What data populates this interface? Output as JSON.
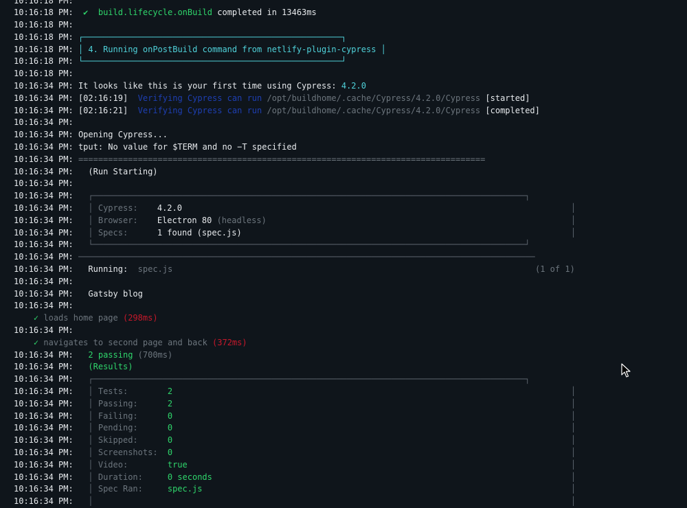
{
  "timestamps": {
    "t1": "10:16:18 PM:",
    "t2": "10:16:34 PM:"
  },
  "build": {
    "check": "✔",
    "task": "build.lifecycle.onBuild",
    "completed": " completed in 13463ms"
  },
  "plugin_box": {
    "top": "┌────────────────────────────────────────────────────┐",
    "middle_left": "│",
    "text": " 4. Running onPostBuild command from netlify-plugin-cypress ",
    "middle_right": "│",
    "bottom": "└────────────────────────────────────────────────────┘"
  },
  "cypress": {
    "first_time_prefix": "It looks like this is your first time using Cypress: ",
    "version": "4.2.0",
    "verify1_time": "[02:16:19]",
    "verify2_time": "[02:16:21]",
    "verify_text": "Verifying Cypress can run",
    "path": "/opt/buildhome/.cache/Cypress/4.2.0/Cypress",
    "started": "[started]",
    "completed": "[completed]",
    "opening": "Opening Cypress...",
    "tput": "tput: No value for $TERM and no −T specified",
    "equals_sep": "=================================================================================="
  },
  "run_start": {
    "label": "(Run Starting)",
    "box_top": "┌───────────────────────────────────────────────────────────────────────────────────────┐",
    "box_bottom": "└───────────────────────────────────────────────────────────────────────────────────────┘",
    "rows": [
      {
        "key": "Cypress:",
        "value": "4.2.0",
        "extra": ""
      },
      {
        "key": "Browser:",
        "value": "Electron 80",
        "extra": "(headless)"
      },
      {
        "key": "Specs:",
        "value": "1 found (spec.js)",
        "extra": ""
      }
    ]
  },
  "separator": "────────────────────────────────────────────────────────────────────────────────────────────",
  "running": {
    "label": "Running:",
    "spec": "spec.js",
    "count": "(1 of 1)"
  },
  "suite": {
    "title": "Gatsby blog",
    "test1": {
      "check": "✓",
      "name": "loads home page",
      "time": "(298ms)"
    },
    "test2": {
      "check": "✓",
      "name": "navigates to second page and back",
      "time": "(372ms)"
    },
    "passing": "2 passing",
    "passing_time": "(700ms)"
  },
  "results": {
    "label": "(Results)",
    "box_top": "┌───────────────────────────────────────────────────────────────────────────────────────┐",
    "rows": [
      {
        "key": "Tests:",
        "value": "2"
      },
      {
        "key": "Passing:",
        "value": "2"
      },
      {
        "key": "Failing:",
        "value": "0"
      },
      {
        "key": "Pending:",
        "value": "0"
      },
      {
        "key": "Skipped:",
        "value": "0"
      },
      {
        "key": "Screenshots:",
        "value": "0"
      },
      {
        "key": "Video:",
        "value": "true"
      },
      {
        "key": "Duration:",
        "value": "0 seconds"
      },
      {
        "key": "Spec Ran:",
        "value": "spec.js"
      }
    ]
  },
  "colors": {
    "background": "#0f151b",
    "green": "#2fd56b",
    "cyan": "#4fd1d9",
    "blue": "#1e3fb3",
    "red": "#c9182b",
    "dim": "#6c757d"
  },
  "icons": {
    "cursor": "mouse-pointer-icon"
  }
}
